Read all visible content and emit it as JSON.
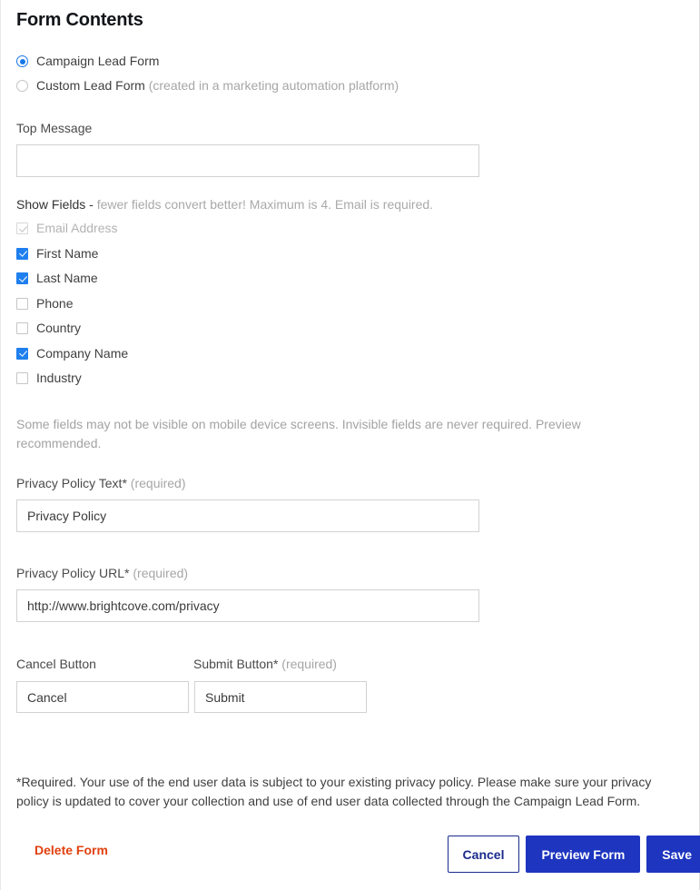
{
  "page": {
    "title": "Form Contents"
  },
  "form_type": {
    "options": [
      {
        "label": "Campaign Lead Form",
        "sub": "",
        "selected": true,
        "disabled": false
      },
      {
        "label": "Custom Lead Form",
        "sub": "(created in a marketing automation platform)",
        "selected": false,
        "disabled": true
      }
    ]
  },
  "top_message": {
    "label": "Top Message",
    "value": "",
    "placeholder": ""
  },
  "show_fields": {
    "label_strong": "Show Fields -",
    "label_hint": " fewer fields convert better! Maximum is 4. Email is required.",
    "items": [
      {
        "label": "Email Address",
        "checked": true,
        "disabled": true
      },
      {
        "label": "First Name",
        "checked": true,
        "disabled": false
      },
      {
        "label": "Last Name",
        "checked": true,
        "disabled": false
      },
      {
        "label": "Phone",
        "checked": false,
        "disabled": false
      },
      {
        "label": "Country",
        "checked": false,
        "disabled": false
      },
      {
        "label": "Company Name",
        "checked": true,
        "disabled": false
      },
      {
        "label": "Industry",
        "checked": false,
        "disabled": false
      }
    ],
    "note": "Some fields may not be visible on mobile device screens. Invisible fields are never required. Preview recommended."
  },
  "privacy_policy_text": {
    "label": "Privacy Policy Text*",
    "required_note": "(required)",
    "value": "Privacy Policy"
  },
  "privacy_policy_url": {
    "label": "Privacy Policy URL*",
    "required_note": "(required)",
    "value": "http://www.brightcove.com/privacy"
  },
  "cancel_button_field": {
    "label": "Cancel Button",
    "required_note": "",
    "value": "Cancel"
  },
  "submit_button_field": {
    "label": "Submit Button*",
    "required_note": "(required)",
    "value": "Submit"
  },
  "disclaimer": {
    "text": "*Required. Your use of the end user data is subject to your existing privacy policy. Please make sure your privacy policy is updated to cover your collection and use of end user data collected through the Campaign Lead Form."
  },
  "actions": {
    "delete_label": "Delete Form",
    "cancel_label": "Cancel",
    "preview_label": "Preview Form",
    "save_label": "Save"
  },
  "colors": {
    "accent_blue": "#1d35bf",
    "checkbox_blue": "#1f7fef",
    "radio_blue": "#1878e8",
    "delete_orange": "#e0400e",
    "secondary_border": "#1a2b8c"
  }
}
